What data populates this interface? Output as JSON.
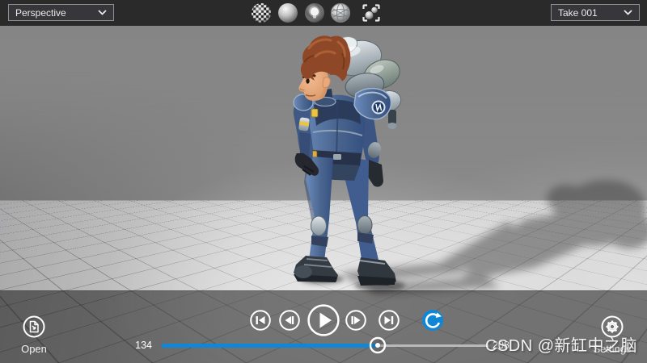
{
  "top_bar": {
    "camera_dropdown": {
      "value": "Perspective"
    },
    "take_dropdown": {
      "value": "Take 001"
    },
    "shading_buttons": [
      {
        "icon": "texture-sphere-icon"
      },
      {
        "icon": "shaded-sphere-icon"
      },
      {
        "icon": "lighting-bulb-sphere-icon"
      },
      {
        "icon": "wireframe-sphere-icon"
      },
      {
        "icon": "frame-objects-icon"
      }
    ]
  },
  "viewport": {
    "content": "male sci-fi character with jetpack standing on gray grid floor, long shadow cast to the right"
  },
  "transport": {
    "loop_enabled": true
  },
  "timeline": {
    "current_frame": "134",
    "total_frames": "208",
    "progress_percent": 66
  },
  "open_button": {
    "label": "Open"
  },
  "settings_button": {
    "label": "Settings"
  },
  "watermark": {
    "text": "CSDN @新缸中之脑"
  },
  "colors": {
    "accent_blue": "#0f86d6",
    "top_bar": "#2a2a2a",
    "viewport_gray": "#868686"
  }
}
